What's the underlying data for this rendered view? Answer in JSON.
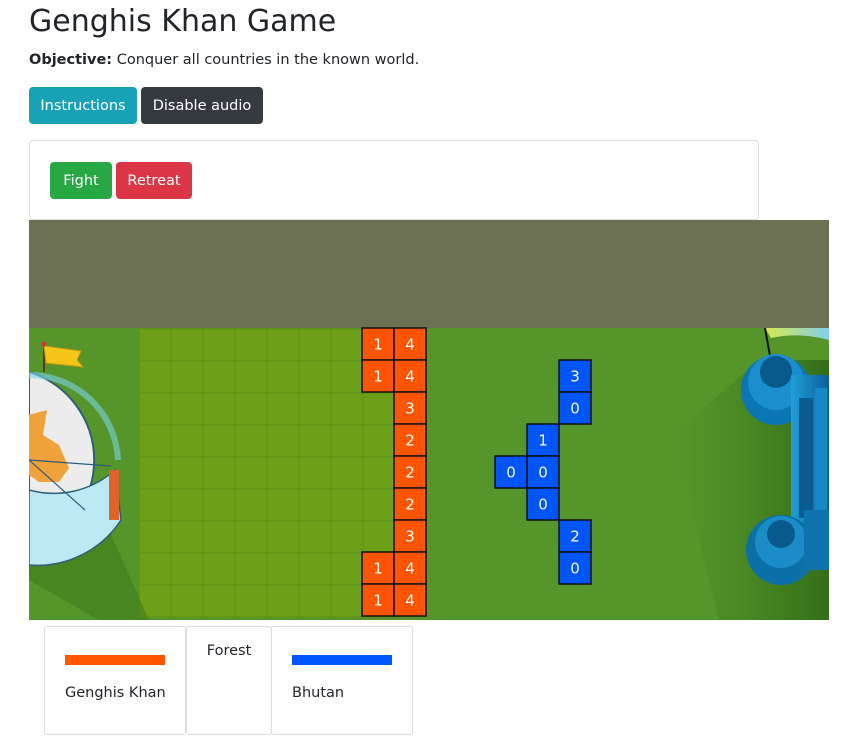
{
  "header": {
    "title": "Genghis Khan Game",
    "objective_label": "Objective:",
    "objective_text": "Conquer all countries in the known world."
  },
  "toolbar": {
    "instructions_label": "Instructions",
    "audio_label": "Disable audio"
  },
  "actions": {
    "fight_label": "Fight",
    "retreat_label": "Retreat"
  },
  "colors": {
    "player": "#ff5500",
    "enemy": "#0055ff",
    "grass": "#55952a",
    "sky": "#6b7152",
    "forest": "#6da018"
  },
  "board": {
    "player_columns": [
      [
        1,
        1,
        null,
        null,
        null,
        null,
        null,
        1,
        1
      ],
      [
        4,
        4,
        3,
        2,
        2,
        2,
        3,
        4,
        4
      ]
    ],
    "enemy_cells": [
      {
        "col": 0,
        "row": 4,
        "value": 0
      },
      {
        "col": 1,
        "row": 3,
        "value": 1
      },
      {
        "col": 1,
        "row": 4,
        "value": 0
      },
      {
        "col": 1,
        "row": 5,
        "value": 0
      },
      {
        "col": 2,
        "row": 1,
        "value": 3
      },
      {
        "col": 2,
        "row": 2,
        "value": 0
      },
      {
        "col": 2,
        "row": 6,
        "value": 2
      },
      {
        "col": 2,
        "row": 7,
        "value": 0
      }
    ]
  },
  "legend": [
    {
      "name": "Genghis Khan",
      "color": "#ff5500"
    },
    {
      "name": "Forest"
    },
    {
      "name": "Bhutan",
      "color": "#0055ff"
    }
  ]
}
